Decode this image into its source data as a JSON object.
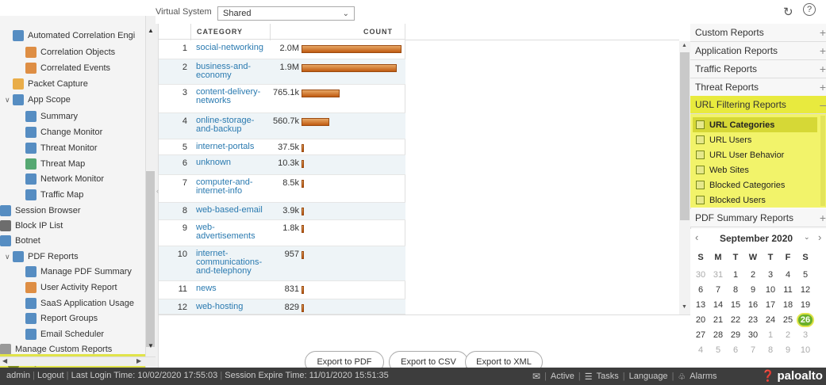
{
  "topbar": {
    "vsys_label": "Virtual System",
    "vsys_value": "Shared"
  },
  "nav": {
    "items": [
      {
        "label": "Automated Correlation Engi",
        "name": "nav-item-automated-correlation-engine"
      },
      {
        "label": "Correlation Objects",
        "name": "nav-item-correlation-objects"
      },
      {
        "label": "Correlated Events",
        "name": "nav-item-correlated-events"
      },
      {
        "label": "Packet Capture",
        "name": "nav-item-packet-capture"
      },
      {
        "label": "App Scope",
        "name": "nav-item-app-scope"
      },
      {
        "label": "Summary",
        "name": "nav-item-summary"
      },
      {
        "label": "Change Monitor",
        "name": "nav-item-change-monitor"
      },
      {
        "label": "Threat Monitor",
        "name": "nav-item-threat-monitor"
      },
      {
        "label": "Threat Map",
        "name": "nav-item-threat-map"
      },
      {
        "label": "Network Monitor",
        "name": "nav-item-network-monitor"
      },
      {
        "label": "Traffic Map",
        "name": "nav-item-traffic-map"
      },
      {
        "label": "Session Browser",
        "name": "nav-item-session-browser"
      },
      {
        "label": "Block IP List",
        "name": "nav-item-block-ip-list"
      },
      {
        "label": "Botnet",
        "name": "nav-item-botnet"
      },
      {
        "label": "PDF Reports",
        "name": "nav-item-pdf-reports"
      },
      {
        "label": "Manage PDF Summary",
        "name": "nav-item-manage-pdf-summary"
      },
      {
        "label": "User Activity Report",
        "name": "nav-item-user-activity-report"
      },
      {
        "label": "SaaS Application Usage",
        "name": "nav-item-saas-application-usage"
      },
      {
        "label": "Report Groups",
        "name": "nav-item-report-groups"
      },
      {
        "label": "Email Scheduler",
        "name": "nav-item-email-scheduler"
      },
      {
        "label": "Manage Custom Reports",
        "name": "nav-item-manage-custom-reports"
      },
      {
        "label": "Reports",
        "name": "nav-item-reports"
      }
    ]
  },
  "table": {
    "headers": {
      "category": "CATEGORY",
      "count": "COUNT"
    },
    "rows": [
      {
        "num": "1",
        "category": "social-networking",
        "count": "2.0M",
        "value": 2000000
      },
      {
        "num": "2",
        "category": "business-and-economy",
        "count": "1.9M",
        "value": 1900000
      },
      {
        "num": "3",
        "category": "content-delivery-networks",
        "count": "765.1k",
        "value": 765100
      },
      {
        "num": "4",
        "category": "online-storage-and-backup",
        "count": "560.7k",
        "value": 560700
      },
      {
        "num": "5",
        "category": "internet-portals",
        "count": "37.5k",
        "value": 37500
      },
      {
        "num": "6",
        "category": "unknown",
        "count": "10.3k",
        "value": 10300
      },
      {
        "num": "7",
        "category": "computer-and-internet-info",
        "count": "8.5k",
        "value": 8500
      },
      {
        "num": "8",
        "category": "web-based-email",
        "count": "3.9k",
        "value": 3900
      },
      {
        "num": "9",
        "category": "web-advertisements",
        "count": "1.8k",
        "value": 1800
      },
      {
        "num": "10",
        "category": "internet-communications-and-telephony",
        "count": "957",
        "value": 957
      },
      {
        "num": "11",
        "category": "news",
        "count": "831",
        "value": 831
      },
      {
        "num": "12",
        "category": "web-hosting",
        "count": "829",
        "value": 829
      }
    ]
  },
  "export": {
    "pdf": "Export to PDF",
    "csv": "Export to CSV",
    "xml": "Export to XML"
  },
  "right_panel": {
    "sections": {
      "custom": "Custom Reports",
      "application": "Application Reports",
      "traffic": "Traffic Reports",
      "threat": "Threat Reports",
      "url": "URL Filtering Reports",
      "pdf_summary": "PDF Summary Reports"
    },
    "url_items": [
      "URL Categories",
      "URL Users",
      "URL User Behavior",
      "Web Sites",
      "Blocked Categories",
      "Blocked Users"
    ]
  },
  "calendar": {
    "month": "September 2020",
    "weekdays": [
      "S",
      "M",
      "T",
      "W",
      "T",
      "F",
      "S"
    ],
    "weeks": [
      [
        "30",
        "31",
        "1",
        "2",
        "3",
        "4",
        "5"
      ],
      [
        "6",
        "7",
        "8",
        "9",
        "10",
        "11",
        "12"
      ],
      [
        "13",
        "14",
        "15",
        "16",
        "17",
        "18",
        "19"
      ],
      [
        "20",
        "21",
        "22",
        "23",
        "24",
        "25",
        "26"
      ],
      [
        "27",
        "28",
        "29",
        "30",
        "1",
        "2",
        "3"
      ],
      [
        "4",
        "5",
        "6",
        "7",
        "8",
        "9",
        "10"
      ]
    ],
    "selected": "26"
  },
  "footer": {
    "user": "admin",
    "logout": "Logout",
    "last_login": "Last Login Time: 10/02/2020 17:55:03",
    "session_expire": "Session Expire Time: 11/01/2020 15:51:35",
    "active": "Active",
    "tasks": "Tasks",
    "language": "Language",
    "alarms": "Alarms",
    "brand": "paloalto"
  },
  "colors": {
    "accent": "#e0e34a",
    "bar": "#d27a2e",
    "link": "#2a7ab0",
    "footer": "#3d3d3d"
  }
}
